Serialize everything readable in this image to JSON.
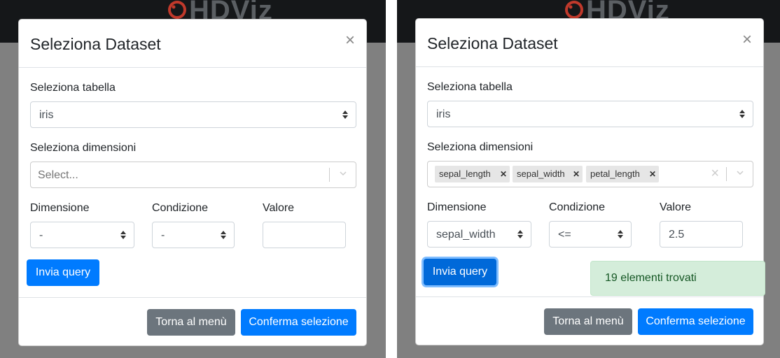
{
  "app": {
    "logo_text": "HDViz"
  },
  "modal": {
    "title": "Seleziona Dataset",
    "close_glyph": "×",
    "table_label": "Seleziona tabella",
    "dims_label": "Seleziona dimensioni",
    "col_dimension": "Dimensione",
    "col_condition": "Condizione",
    "col_value": "Valore",
    "send_query": "Invia query",
    "back_menu": "Torna al menù",
    "confirm": "Conferma selezione"
  },
  "left": {
    "table_value": "iris",
    "dims_placeholder": "Select...",
    "dimension_value": "-",
    "condition_value": "-",
    "value_input": ""
  },
  "right": {
    "table_value": "iris",
    "chips": [
      "sepal_length",
      "sepal_width",
      "petal_length"
    ],
    "dimension_value": "sepal_width",
    "condition_value": "<=",
    "value_input": "2.5",
    "alert": "19 elementi trovati"
  },
  "colors": {
    "primary": "#007bff",
    "secondary": "#6c757d",
    "success_bg": "#d4edda",
    "success_text": "#155724"
  }
}
